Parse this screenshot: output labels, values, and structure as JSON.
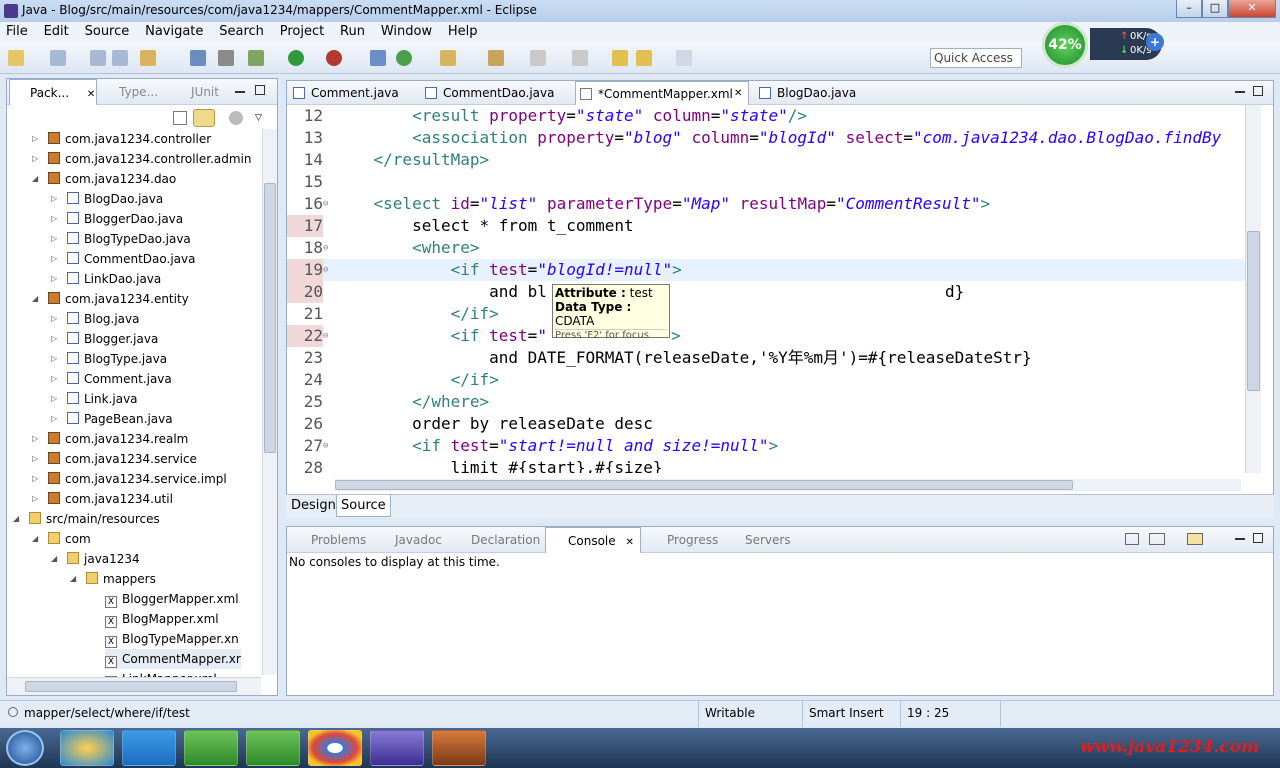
{
  "window": {
    "title": "Java - Blog/src/main/resources/com/java1234/mappers/CommentMapper.xml - Eclipse",
    "minimize": "–",
    "maximize": "□",
    "close": "✕"
  },
  "menu": [
    "File",
    "Edit",
    "Source",
    "Navigate",
    "Search",
    "Project",
    "Run",
    "Window",
    "Help"
  ],
  "quick_access": {
    "placeholder": "Quick Access"
  },
  "cpu_meter": {
    "percent": "42%",
    "up": "0K/s",
    "down": "0K/s"
  },
  "package_explorer": {
    "tabs": [
      "Pack...",
      "Type...",
      "JUnit"
    ],
    "items": [
      {
        "label": "com.java1234.controller",
        "icon": "package-icon",
        "level": 3,
        "expanded": false
      },
      {
        "label": "com.java1234.controller.admin",
        "icon": "package-icon",
        "level": 3,
        "expanded": false
      },
      {
        "label": "com.java1234.dao",
        "icon": "package-icon",
        "level": 3,
        "expanded": true
      },
      {
        "label": "BlogDao.java",
        "icon": "java-file-icon",
        "level": 4,
        "expanded": false
      },
      {
        "label": "BloggerDao.java",
        "icon": "java-file-icon",
        "level": 4,
        "expanded": false
      },
      {
        "label": "BlogTypeDao.java",
        "icon": "java-file-icon",
        "level": 4,
        "expanded": false
      },
      {
        "label": "CommentDao.java",
        "icon": "java-file-icon",
        "level": 4,
        "expanded": false
      },
      {
        "label": "LinkDao.java",
        "icon": "java-file-icon",
        "level": 4,
        "expanded": false
      },
      {
        "label": "com.java1234.entity",
        "icon": "package-icon",
        "level": 3,
        "expanded": true
      },
      {
        "label": "Blog.java",
        "icon": "java-file-icon",
        "level": 4,
        "expanded": false
      },
      {
        "label": "Blogger.java",
        "icon": "java-file-icon",
        "level": 4,
        "expanded": false
      },
      {
        "label": "BlogType.java",
        "icon": "java-file-icon",
        "level": 4,
        "expanded": false
      },
      {
        "label": "Comment.java",
        "icon": "java-file-icon",
        "level": 4,
        "expanded": false
      },
      {
        "label": "Link.java",
        "icon": "java-file-icon",
        "level": 4,
        "expanded": false
      },
      {
        "label": "PageBean.java",
        "icon": "java-file-icon",
        "level": 4,
        "expanded": false
      },
      {
        "label": "com.java1234.realm",
        "icon": "package-icon",
        "level": 3,
        "expanded": false
      },
      {
        "label": "com.java1234.service",
        "icon": "package-icon",
        "level": 3,
        "expanded": false
      },
      {
        "label": "com.java1234.service.impl",
        "icon": "package-icon",
        "level": 3,
        "expanded": false
      },
      {
        "label": "com.java1234.util",
        "icon": "package-icon",
        "level": 3,
        "expanded": false
      },
      {
        "label": "src/main/resources",
        "icon": "folder-icon",
        "level": 2,
        "expanded": true
      },
      {
        "label": "com",
        "icon": "folder-icon",
        "level": 3,
        "expanded": true
      },
      {
        "label": "java1234",
        "icon": "folder-icon",
        "level": 4,
        "expanded": true
      },
      {
        "label": "mappers",
        "icon": "folder-icon",
        "level": 5,
        "expanded": true
      },
      {
        "label": "BloggerMapper.xml",
        "icon": "xml-file-icon",
        "level": 6,
        "expanded": false
      },
      {
        "label": "BlogMapper.xml",
        "icon": "xml-file-icon",
        "level": 6,
        "expanded": false
      },
      {
        "label": "BlogTypeMapper.xn",
        "icon": "xml-file-icon",
        "level": 6,
        "expanded": false
      },
      {
        "label": "CommentMapper.xr",
        "icon": "xml-file-icon",
        "level": 6,
        "expanded": false
      },
      {
        "label": "LinkMapper.xml",
        "icon": "xml-file-icon",
        "level": 6,
        "expanded": false
      }
    ]
  },
  "editor": {
    "tabs": [
      {
        "label": "Comment.java"
      },
      {
        "label": "CommentDao.java"
      },
      {
        "label": "*CommentMapper.xml",
        "active": true
      },
      {
        "label": "BlogDao.java"
      }
    ],
    "lines": [
      {
        "n": "12",
        "t": "        <result property=\"state\" column=\"state\"/>"
      },
      {
        "n": "13",
        "t": "        <association property=\"blog\" column=\"blogId\" select=\"com.java1234.dao.BlogDao.findBy"
      },
      {
        "n": "14",
        "t": "    </resultMap>"
      },
      {
        "n": "15",
        "t": ""
      },
      {
        "n": "16",
        "t": "    <select id=\"list\" parameterType=\"Map\" resultMap=\"CommentResult\">"
      },
      {
        "n": "17",
        "t": "        select * from t_comment"
      },
      {
        "n": "18",
        "t": "        <where>"
      },
      {
        "n": "19",
        "t": "            <if test=\"blogId!=null\">"
      },
      {
        "n": "20",
        "t": "                and bl"
      },
      {
        "n": "21",
        "t": "            </if>"
      },
      {
        "n": "22",
        "t": "            <if test=\""
      },
      {
        "n": "23",
        "t": "                and DATE_FORMAT(releaseDate,'%Y年%m月')=#{releaseDateStr}"
      },
      {
        "n": "24",
        "t": "            </if>"
      },
      {
        "n": "25",
        "t": "        </where>"
      },
      {
        "n": "26",
        "t": "        order by releaseDate desc"
      },
      {
        "n": "27",
        "t": "        <if test=\"start!=null and size!=null\">"
      },
      {
        "n": "28",
        "t": "            limit #{start},#{size}"
      }
    ],
    "line20_tail": "d}",
    "line22_tail": ">",
    "tooltip": {
      "attr_label": "Attribute :",
      "attr_value": "test",
      "type_label": "Data Type :",
      "type_value": "CDATA",
      "hint": "Press 'F2' for focus"
    },
    "bottom_tabs": [
      "Design",
      "Source"
    ]
  },
  "console_panel": {
    "tabs": [
      "Problems",
      "Javadoc",
      "Declaration",
      "Console",
      "Progress",
      "Servers"
    ],
    "message": "No consoles to display at this time."
  },
  "status": {
    "path": "mapper/select/where/if/test",
    "mode": "Writable",
    "insert": "Smart Insert",
    "position": "19 : 25"
  },
  "watermark": "www.java1234.com",
  "colors": {
    "tag": "#2f7f7f",
    "attr": "#7f007f",
    "value": "#2a00ff"
  }
}
